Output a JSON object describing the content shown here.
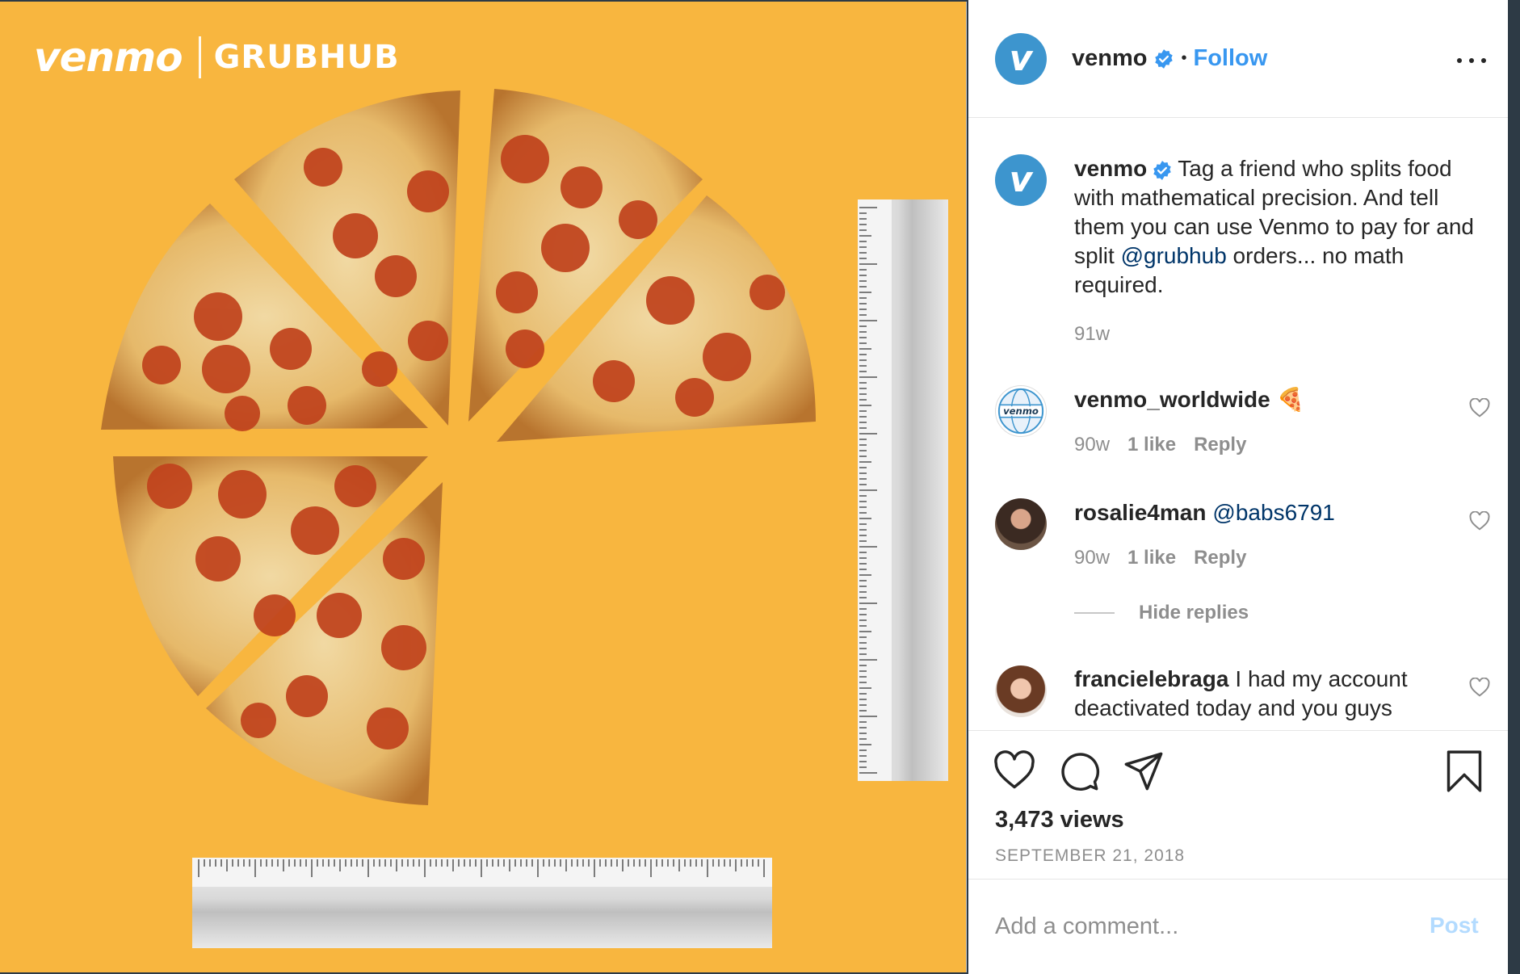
{
  "media": {
    "brand_venmo": "venmo",
    "brand_partner": "GRUBHUB",
    "background_color": "#f8b63f"
  },
  "header": {
    "username": "venmo",
    "separator": "•",
    "follow_label": "Follow"
  },
  "caption": {
    "username": "venmo",
    "text_before": "Tag a friend who splits food with mathematical precision. And tell them you can use Venmo to pay for and split ",
    "mention": "@grubhub",
    "text_after": " orders... no math required.",
    "time": "91w"
  },
  "comments": [
    {
      "username": "venmo_worldwide",
      "text": "🍕",
      "time": "90w",
      "likes": "1 like",
      "reply": "Reply"
    },
    {
      "username": "rosalie4man",
      "text": "@babs6791",
      "time": "90w",
      "likes": "1 like",
      "reply": "Reply"
    },
    {
      "username": "francielebraga",
      "text": "I had my account deactivated today and you guys"
    }
  ],
  "hide_replies_label": "Hide replies",
  "stats": {
    "views": "3,473 views",
    "date": "SEPTEMBER 21, 2018"
  },
  "comment_box": {
    "placeholder": "Add a comment...",
    "post_label": "Post"
  },
  "colors": {
    "accent": "#3897f0",
    "venmo_blue": "#3d95ce",
    "mention": "#003569",
    "muted": "#8e8e8e"
  },
  "icons": [
    "verified-badge-icon",
    "more-options-icon",
    "heart-icon",
    "comment-icon",
    "share-icon",
    "bookmark-icon"
  ]
}
